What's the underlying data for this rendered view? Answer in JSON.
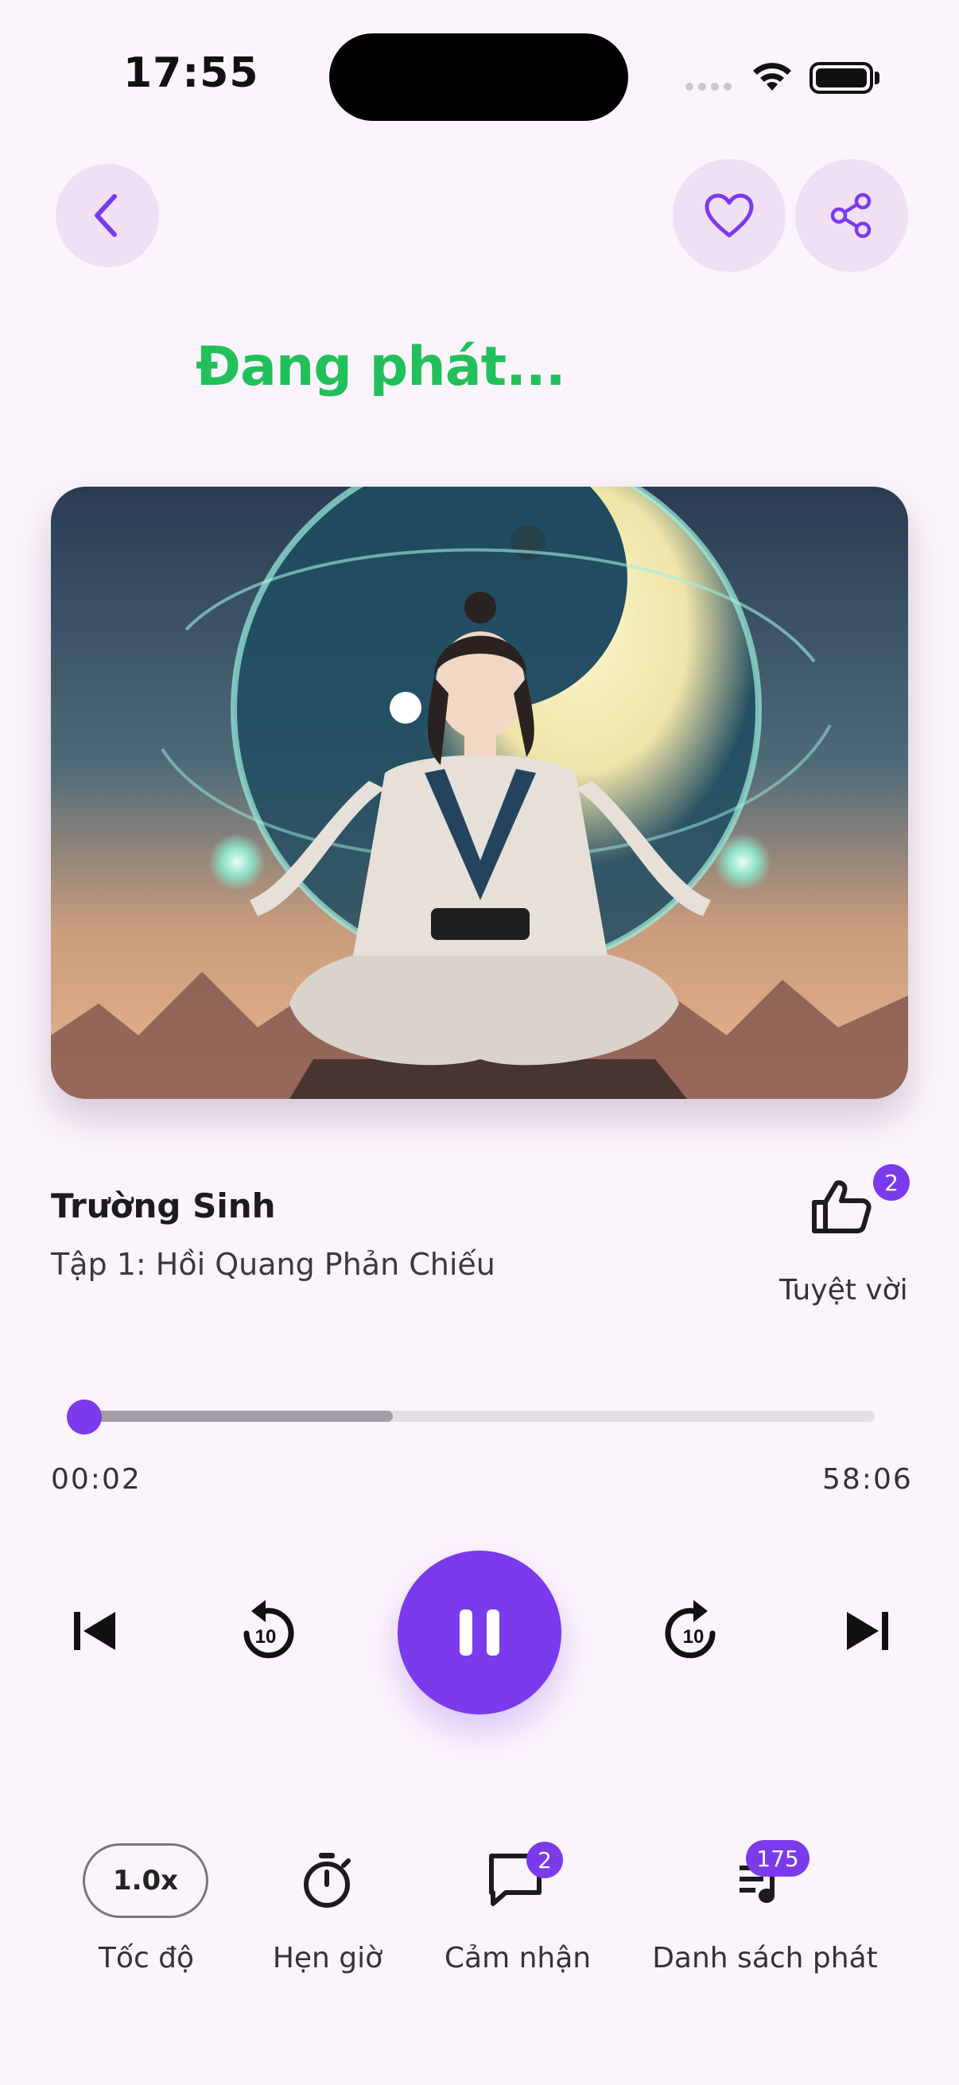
{
  "status_bar": {
    "time": "17:55"
  },
  "header": {
    "back_icon": "chevron-left-icon",
    "favorite_icon": "heart-icon",
    "share_icon": "share-icon",
    "now_playing": "Đang phát..."
  },
  "track": {
    "book_title": "Trường Sinh",
    "episode_title": "Tập 1: Hồi Quang Phản Chiếu",
    "like_count": "2",
    "like_label": "Tuyệt vời"
  },
  "progress": {
    "current_time": "00:02",
    "total_time": "58:06",
    "played_fraction": 0.0,
    "buffered_fraction": 0.39
  },
  "controls": {
    "rewind_seconds": "10",
    "forward_seconds": "10",
    "state": "playing"
  },
  "bottom_bar": {
    "speed_value": "1.0x",
    "speed_label": "Tốc độ",
    "timer_label": "Hẹn giờ",
    "comments_label": "Cảm nhận",
    "comments_count": "2",
    "playlist_label": "Danh sách phát",
    "playlist_count": "175"
  },
  "colors": {
    "accent": "#7c3aed",
    "now_playing": "#22c05a",
    "background": "#fcf4fc",
    "button_bg": "#efe0f4"
  }
}
